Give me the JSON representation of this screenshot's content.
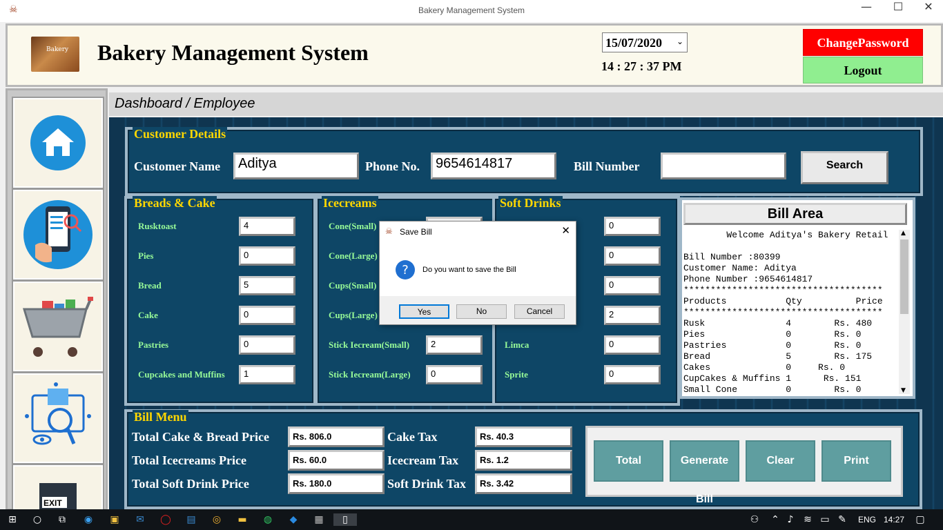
{
  "window": {
    "title": "Bakery Management System"
  },
  "header": {
    "app_title": "Bakery Management System",
    "logo_text": "Bakery",
    "date": "15/07/2020",
    "time": "14 : 27 : 37 PM",
    "change_password_label": "ChangePassword",
    "logout_label": "Logout"
  },
  "breadcrumb": "Dashboard / Employee",
  "sidebar": [
    {
      "name": "home-icon"
    },
    {
      "name": "customer-search-icon"
    },
    {
      "name": "shopping-cart-icon"
    },
    {
      "name": "analytics-icon"
    },
    {
      "name": "exit-icon",
      "label": "EXIT"
    }
  ],
  "customer": {
    "section_title": "Customer Details",
    "name_label": "Customer Name",
    "name_value": "Aditya",
    "phone_label": "Phone No.",
    "phone_value": "9654614817",
    "bill_label": "Bill Number",
    "bill_value": "",
    "search_label": "Search"
  },
  "breads": {
    "title": "Breads & Cake",
    "items": [
      {
        "label": "Rusktoast",
        "qty": "4"
      },
      {
        "label": "Pies",
        "qty": "0"
      },
      {
        "label": "Bread",
        "qty": "5"
      },
      {
        "label": "Cake",
        "qty": "0"
      },
      {
        "label": "Pastries",
        "qty": "0"
      },
      {
        "label": "Cupcakes and Muffins",
        "qty": "1"
      }
    ]
  },
  "icecreams": {
    "title": "Icecreams",
    "items": [
      {
        "label": "Cone(Small)",
        "qty": ""
      },
      {
        "label": "Cone(Large)",
        "qty": ""
      },
      {
        "label": "Cups(Small)",
        "qty": ""
      },
      {
        "label": "Cups(Large)",
        "qty": ""
      },
      {
        "label": "Stick Iecream(Small)",
        "qty": "2"
      },
      {
        "label": "Stick Iecream(Large)",
        "qty": "0"
      }
    ]
  },
  "drinks": {
    "title": "Soft Drinks",
    "items": [
      {
        "label": "",
        "qty": "0"
      },
      {
        "label": "",
        "qty": "0"
      },
      {
        "label": "",
        "qty": "0"
      },
      {
        "label": "",
        "qty": "2"
      },
      {
        "label": "Limca",
        "qty": "0"
      },
      {
        "label": "Sprite",
        "qty": "0"
      }
    ]
  },
  "bill_area": {
    "title": "Bill Area",
    "text": "        Welcome Aditya's Bakery Retail\n\nBill Number :80399\nCustomer Name: Aditya\nPhone Number :9654614817\n*************************************\nProducts           Qty          Price\n*************************************\nRusk               4        Rs. 480\nPies               0        Rs. 0\nPastries           0        Rs. 0\nBread              5        Rs. 175\nCakes              0     Rs. 0\nCupCakes & Muffins 1      Rs. 151\nSmall Cone         0        Rs. 0"
  },
  "bill_menu": {
    "title": "Bill Menu",
    "rows": [
      {
        "label": "Total Cake & Bread Price",
        "value": "Rs. 806.0",
        "tax_label": "Cake Tax",
        "tax_value": "Rs. 40.3"
      },
      {
        "label": "Total Icecreams Price",
        "value": "Rs. 60.0",
        "tax_label": "Icecream Tax",
        "tax_value": "Rs. 1.2"
      },
      {
        "label": "Total Soft Drink Price",
        "value": "Rs. 180.0",
        "tax_label": "Soft Drink Tax",
        "tax_value": "Rs. 3.42"
      }
    ],
    "buttons": {
      "total": "Total",
      "generate": "Generate Bill",
      "clear": "Clear",
      "print": "Print"
    }
  },
  "dialog": {
    "title": "Save Bill",
    "message": "Do you want to save the Bill",
    "yes": "Yes",
    "no": "No",
    "cancel": "Cancel"
  },
  "taskbar": {
    "language": "ENG",
    "time": "14:27"
  },
  "colors": {
    "panel": "#0e4666",
    "title_yellow": "#ffd700",
    "label_green": "#98fb98",
    "change_password": "#ff0000",
    "logout": "#90ee90",
    "action_button": "#5f9ea0"
  }
}
